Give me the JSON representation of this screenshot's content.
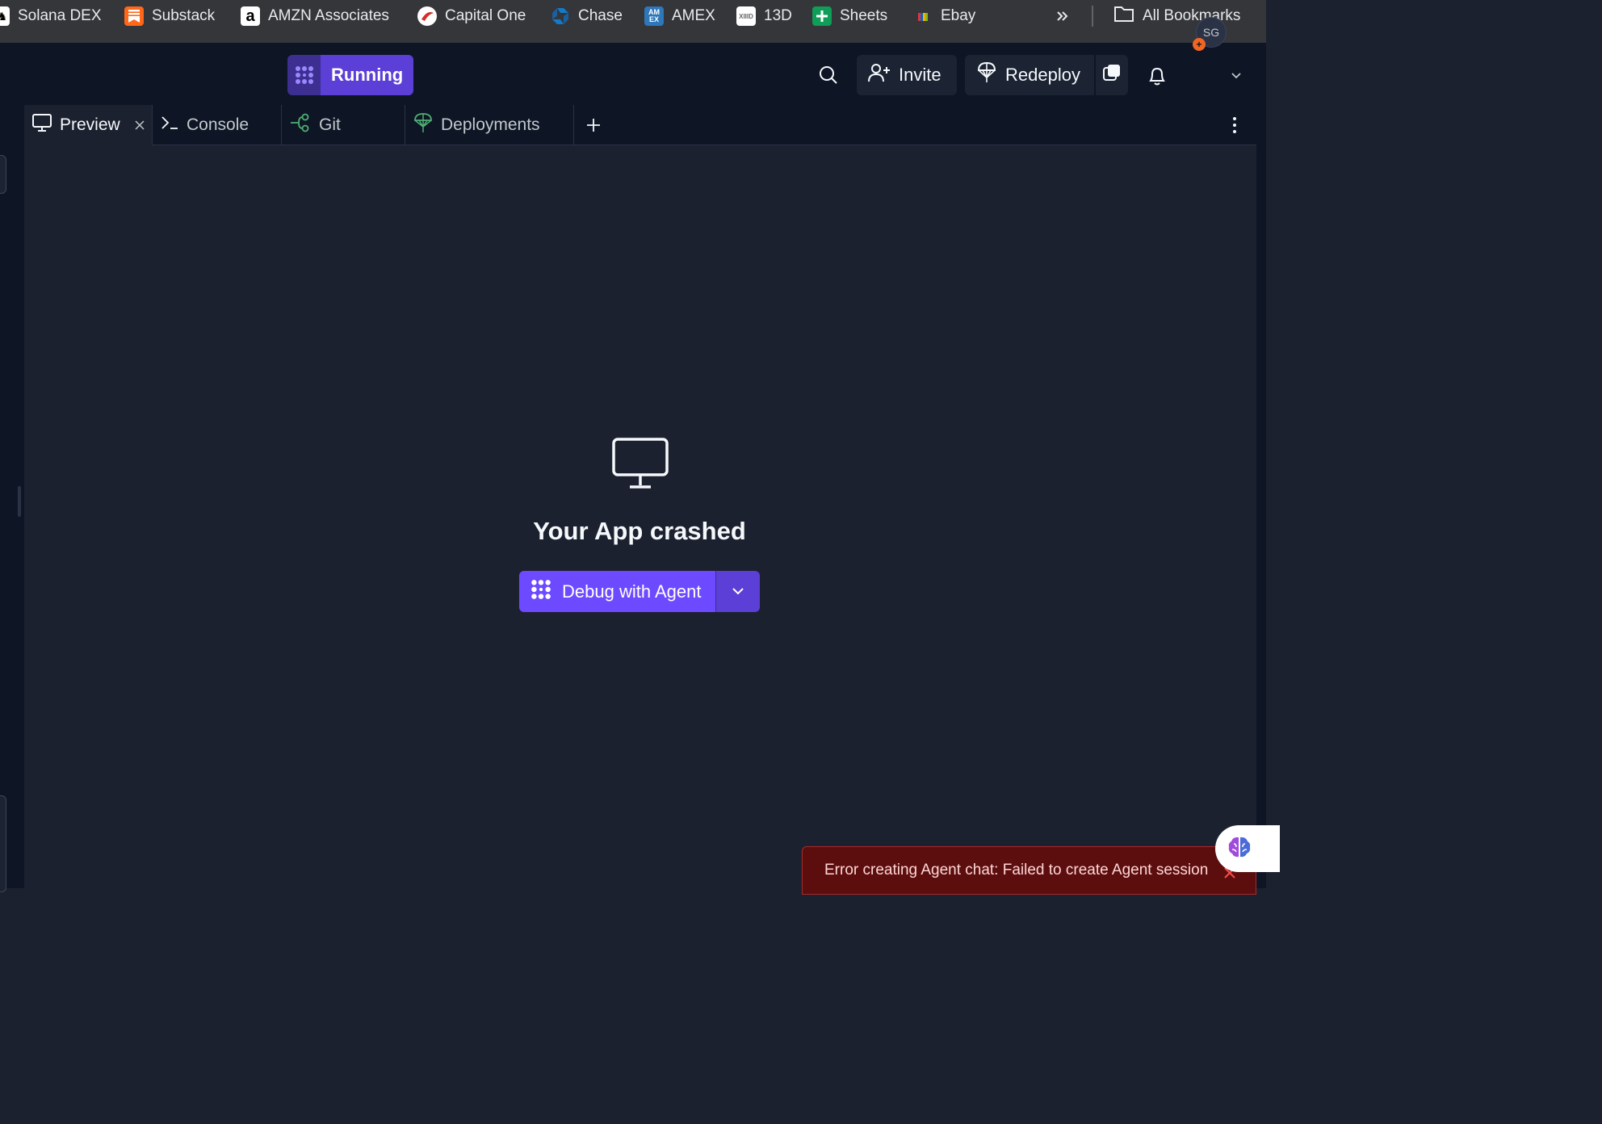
{
  "bookmarks": [
    {
      "label": "Solana DEX",
      "icon": "horse-icon",
      "color": "#ffffff"
    },
    {
      "label": "Substack",
      "icon": "substack-icon",
      "color": "#ff6719"
    },
    {
      "label": "AMZN Associates",
      "icon": "amazon-icon",
      "color": "#ffffff"
    },
    {
      "label": "Capital One",
      "icon": "capital-one-icon",
      "color": "#d03027"
    },
    {
      "label": "Chase",
      "icon": "chase-icon",
      "color": "#117aca"
    },
    {
      "label": "AMEX",
      "icon": "amex-icon",
      "color": "#2e77bb"
    },
    {
      "label": "13D",
      "icon": "13d-icon",
      "color": "#ffffff"
    },
    {
      "label": "Sheets",
      "icon": "sheets-icon",
      "color": "#0f9d58"
    },
    {
      "label": "Ebay",
      "icon": "ebay-icon",
      "color": "#e53238"
    }
  ],
  "all_bookmarks": "All Bookmarks",
  "header": {
    "status": "Running",
    "invite": "Invite",
    "redeploy": "Redeploy",
    "avatar_initials": "SG",
    "accent": "#5b3fd6"
  },
  "tabs": [
    {
      "label": "Preview",
      "icon": "monitor-icon",
      "active": true
    },
    {
      "label": "Console",
      "icon": "terminal-icon",
      "active": false
    },
    {
      "label": "Git",
      "icon": "git-icon",
      "active": false
    },
    {
      "label": "Deployments",
      "icon": "deployments-icon",
      "active": false
    }
  ],
  "main": {
    "title": "Your App crashed",
    "debug_button": "Debug with Agent"
  },
  "toast": {
    "message": "Error creating Agent chat: Failed to create Agent session",
    "color": "#5c0e0e"
  }
}
